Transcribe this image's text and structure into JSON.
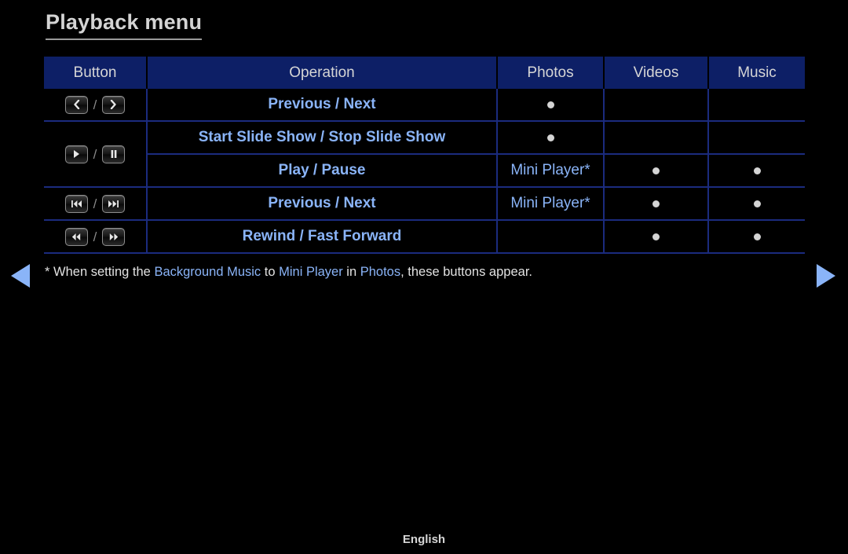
{
  "page": {
    "title": "Playback menu",
    "language_footer": "English"
  },
  "table": {
    "headers": [
      "Button",
      "Operation",
      "Photos",
      "Videos",
      "Music"
    ],
    "rows": [
      {
        "buttons": [
          "prev-chevron-icon",
          "next-chevron-icon"
        ],
        "separator": "/",
        "operation": "Previous / Next",
        "photos": "dot",
        "videos": "",
        "music": ""
      },
      {
        "buttons": [
          "play-icon",
          "pause-icon"
        ],
        "separator": "/",
        "operation": "Start Slide Show / Stop Slide Show",
        "photos": "dot",
        "videos": "",
        "music": ""
      },
      {
        "buttons": [],
        "separator": "",
        "operation": "Play / Pause",
        "photos": "Mini Player*",
        "videos": "dot",
        "music": "dot"
      },
      {
        "buttons": [
          "skip-previous-icon",
          "skip-next-icon"
        ],
        "separator": "/",
        "operation": "Previous / Next",
        "photos": "Mini Player*",
        "videos": "dot",
        "music": "dot"
      },
      {
        "buttons": [
          "rewind-icon",
          "fast-forward-icon"
        ],
        "separator": "/",
        "operation": "Rewind / Fast Forward",
        "photos": "",
        "videos": "dot",
        "music": "dot"
      }
    ]
  },
  "footnote": {
    "marker": "* ",
    "part1": "When setting the ",
    "term1": "Background Music",
    "part2": " to ",
    "term2": "Mini Player",
    "part3": " in ",
    "term3": "Photos",
    "part4": ", these buttons appear."
  },
  "nav": {
    "prev_label": "left-triangle",
    "next_label": "right-triangle"
  },
  "colors": {
    "header_blue": "#0d1f66",
    "grid_blue": "#1b2b7e",
    "accent_blue": "#8ab4f8",
    "text_light": "#d8d8d8",
    "background": "#000000"
  }
}
